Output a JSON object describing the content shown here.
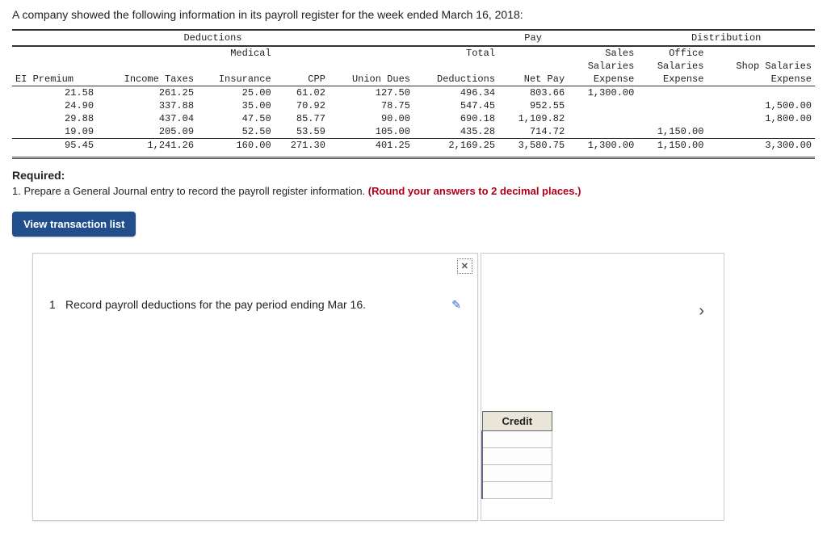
{
  "intro": "A company showed the following information in its payroll register for the week ended March 16, 2018:",
  "headers": {
    "deductions": "Deductions",
    "pay": "Pay",
    "distribution": "Distribution",
    "ei": "EI Premium",
    "inc": "Income Taxes",
    "med1": "Medical",
    "med2": "Insurance",
    "cpp": "CPP",
    "union": "Union Dues",
    "total1": "Total",
    "total2": "Deductions",
    "netpay": "Net Pay",
    "sales1": "Sales",
    "sales2": "Salaries",
    "sales3": "Expense",
    "office1": "Office",
    "office2": "Salaries",
    "office3": "Expense",
    "shop1": "Shop Salaries",
    "shop2": "Expense"
  },
  "rows": [
    {
      "ei": "21.58",
      "inc": "261.25",
      "med": "25.00",
      "cpp": "61.02",
      "union": "127.50",
      "tot": "496.34",
      "net": "803.66",
      "sales": "1,300.00",
      "office": "",
      "shop": ""
    },
    {
      "ei": "24.90",
      "inc": "337.88",
      "med": "35.00",
      "cpp": "70.92",
      "union": "78.75",
      "tot": "547.45",
      "net": "952.55",
      "sales": "",
      "office": "",
      "shop": "1,500.00"
    },
    {
      "ei": "29.88",
      "inc": "437.04",
      "med": "47.50",
      "cpp": "85.77",
      "union": "90.00",
      "tot": "690.18",
      "net": "1,109.82",
      "sales": "",
      "office": "",
      "shop": "1,800.00"
    },
    {
      "ei": "19.09",
      "inc": "205.09",
      "med": "52.50",
      "cpp": "53.59",
      "union": "105.00",
      "tot": "435.28",
      "net": "714.72",
      "sales": "",
      "office": "1,150.00",
      "shop": ""
    }
  ],
  "totals": {
    "ei": "95.45",
    "inc": "1,241.26",
    "med": "160.00",
    "cpp": "271.30",
    "union": "401.25",
    "tot": "2,169.25",
    "net": "3,580.75",
    "sales": "1,300.00",
    "office": "1,150.00",
    "shop": "3,300.00"
  },
  "required": {
    "label": "Required:",
    "line": "1. Prepare a General Journal entry to record the payroll register information. ",
    "red": "(Round your answers to 2 decimal places.)"
  },
  "view_btn": "View transaction list",
  "instruction": {
    "num": "1",
    "text": "Record payroll deductions for the pay period ending Mar 16."
  },
  "credit_label": "Credit",
  "close_icon": "✕"
}
